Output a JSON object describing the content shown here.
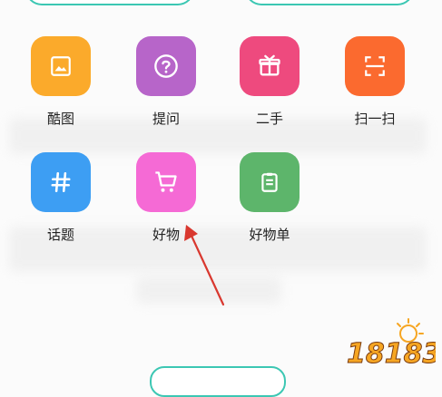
{
  "colors": {
    "accent_teal": "#3cc7b3",
    "arrow_red": "#d9382f"
  },
  "grid": [
    {
      "label": "酷图",
      "icon": "image-icon",
      "color": "#fbaa2b"
    },
    {
      "label": "提问",
      "icon": "question-icon",
      "color": "#b765c9"
    },
    {
      "label": "二手",
      "icon": "gift-box-icon",
      "color": "#ee4a7e"
    },
    {
      "label": "扫一扫",
      "icon": "scan-icon",
      "color": "#fb6a2f"
    },
    {
      "label": "话题",
      "icon": "hashtag-icon",
      "color": "#3d9ef3"
    },
    {
      "label": "好物",
      "icon": "shopping-cart-icon",
      "color": "#f56ad5"
    },
    {
      "label": "好物单",
      "icon": "clipboard-list-icon",
      "color": "#5db56b"
    }
  ],
  "watermark": {
    "text": "18183"
  }
}
